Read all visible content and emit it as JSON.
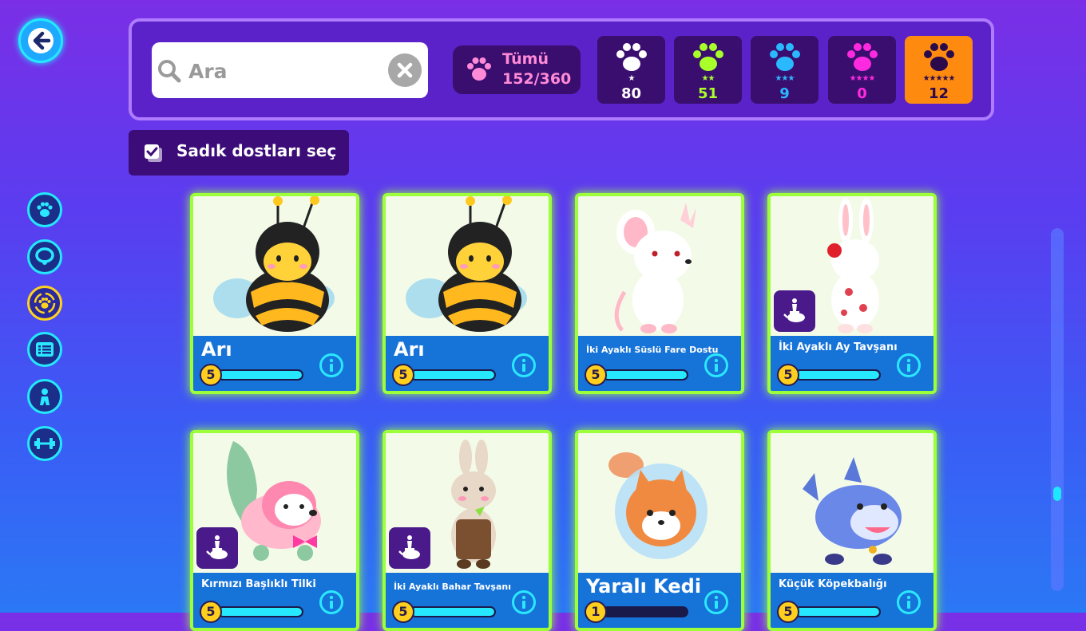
{
  "search": {
    "placeholder": "Ara"
  },
  "filter_all": {
    "label": "Tümü",
    "count": "152/360"
  },
  "rarities": [
    {
      "stars": "★",
      "count": "80",
      "color": "#ffffff",
      "selected": false
    },
    {
      "stars": "★★",
      "count": "51",
      "color": "#a8ff2a",
      "selected": false
    },
    {
      "stars": "★★★",
      "count": "9",
      "color": "#2ab8ff",
      "selected": false
    },
    {
      "stars": "★★★★",
      "count": "0",
      "color": "#ff2ae0",
      "selected": false
    },
    {
      "stars": "★★★★★",
      "count": "12",
      "color": "#2a0a4a",
      "selected": true
    }
  ],
  "loyal_button": {
    "label": "Sadık dostları seç"
  },
  "sidebar": {
    "items": [
      {
        "icon": "paw-icon",
        "active": false
      },
      {
        "icon": "collar-icon",
        "active": false
      },
      {
        "icon": "paw-cycle-icon",
        "active": true
      },
      {
        "icon": "list-icon",
        "active": false
      },
      {
        "icon": "character-icon",
        "active": false
      },
      {
        "icon": "dumbbell-icon",
        "active": false
      }
    ]
  },
  "cards": [
    {
      "name": "Arı",
      "level": "5",
      "progress": 1.0,
      "size": "big",
      "mount": false
    },
    {
      "name": "Arı",
      "level": "5",
      "progress": 1.0,
      "size": "big",
      "mount": false
    },
    {
      "name": "İki Ayaklı Süslü Fare Dostu",
      "level": "5",
      "progress": 1.0,
      "size": "small",
      "mount": false
    },
    {
      "name": "İki Ayaklı Ay Tavşanı",
      "level": "5",
      "progress": 1.0,
      "size": "mid",
      "mount": true
    },
    {
      "name": "Kırmızı Başlıklı Tilki",
      "level": "5",
      "progress": 1.0,
      "size": "mid",
      "mount": true
    },
    {
      "name": "İki Ayaklı Bahar Tavşanı",
      "level": "5",
      "progress": 1.0,
      "size": "small",
      "mount": true
    },
    {
      "name": "Yaralı Kedi",
      "level": "1",
      "progress": 0.0,
      "size": "big",
      "mount": false
    },
    {
      "name": "Küçük Köpekbalığı",
      "level": "5",
      "progress": 1.0,
      "size": "mid",
      "mount": false
    }
  ]
}
